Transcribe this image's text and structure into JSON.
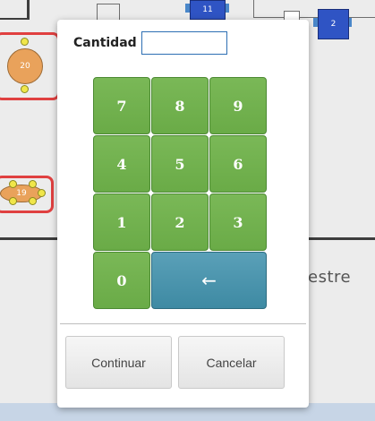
{
  "background": {
    "tables": [
      {
        "number": "20"
      },
      {
        "number": "19"
      },
      {
        "number": "11"
      },
      {
        "number": "2"
      }
    ],
    "area_label": "estre"
  },
  "dialog": {
    "quantity_label": "Cantidad",
    "quantity_value": "",
    "keys": [
      "7",
      "8",
      "9",
      "4",
      "5",
      "6",
      "1",
      "2",
      "3",
      "0"
    ],
    "backspace_symbol": "←",
    "continue_label": "Continuar",
    "cancel_label": "Cancelar"
  },
  "colors": {
    "key_green": "#6aab47",
    "backspace_teal": "#3e8aa3",
    "selection_red": "#e04040",
    "table_orange": "#e9a25b",
    "table_blue": "#2f54c4"
  }
}
